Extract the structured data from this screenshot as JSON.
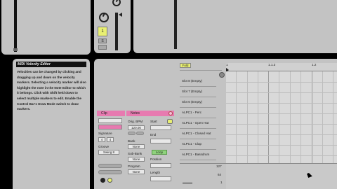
{
  "help": {
    "title": "MIDI Velocity Editor",
    "text": "Velocities can be changed by clicking and dragging up and down on the velocity markers. Selecting a velocity marker will also highlight the note in the Note Editor to which it belongs. Click with Shift held down to select multiple markers to edit. Enable the Control Bar's Draw Mode switch to draw markers."
  },
  "mixer": {
    "track_button": "1",
    "solo_button": "S"
  },
  "clip_panel": {
    "clip_header": "Clip",
    "signature_label": "Signature",
    "sig_num": "4",
    "sig_den": "4",
    "groove_label": "Groove",
    "groove_value": "Swing 8"
  },
  "notes_panel": {
    "header": "Notes",
    "orig_bpm_label": "Orig. BPM",
    "orig_bpm_value": "120.00",
    "bank_label": "Bank",
    "bank_value": "None",
    "subbank_label": "Sub-Bank",
    "subbank_value": "None",
    "program_label": "Program",
    "program_value": "None",
    "start_label": "Start",
    "end_label": "End",
    "loop_button": "Loop",
    "position_label": "Position",
    "length_label": "Length"
  },
  "note_editor": {
    "fold_button": "Fold",
    "ruler": [
      "1",
      "1.1.3",
      "1.2"
    ],
    "rows": [
      "Slot 8 (Empty)",
      "Slot 7 (Empty)",
      "Slot 6 (Empty)",
      "ALPC1 - Perc",
      "ALPC1 - Open Hat",
      "ALPC1 - Closed Hat",
      "ALPC1 - Clap",
      "ALPC1 - Bassdrum"
    ],
    "velocity_scale": [
      "127",
      "64",
      "1"
    ]
  },
  "colors": {
    "panel": "#c3c3c3",
    "accent_yellow": "#e8ef72",
    "accent_pink": "#e77ab0",
    "loop_green": "#8fd27c",
    "header_bg": "#111111"
  }
}
